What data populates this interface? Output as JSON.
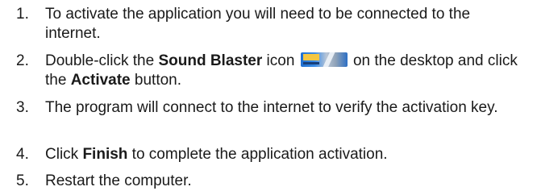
{
  "steps": [
    {
      "number": "1.",
      "text": "To activate the application you will need to be connected to the internet."
    },
    {
      "number": "2.",
      "text_before": "Double-click the ",
      "bold_1": "Sound Blaster",
      "text_middle": " icon ",
      "icon_name": "sound-blaster-icon",
      "text_after_icon": " on the desktop and click the ",
      "bold_2": "Activate",
      "text_end": " button."
    },
    {
      "number": "3.",
      "text": "The program will connect to the internet to verify the activation key."
    },
    {
      "number": "4.",
      "text_before": "Click ",
      "bold": "Finish",
      "text_after": " to complete the application activation."
    },
    {
      "number": "5.",
      "text": "Restart the computer."
    }
  ]
}
